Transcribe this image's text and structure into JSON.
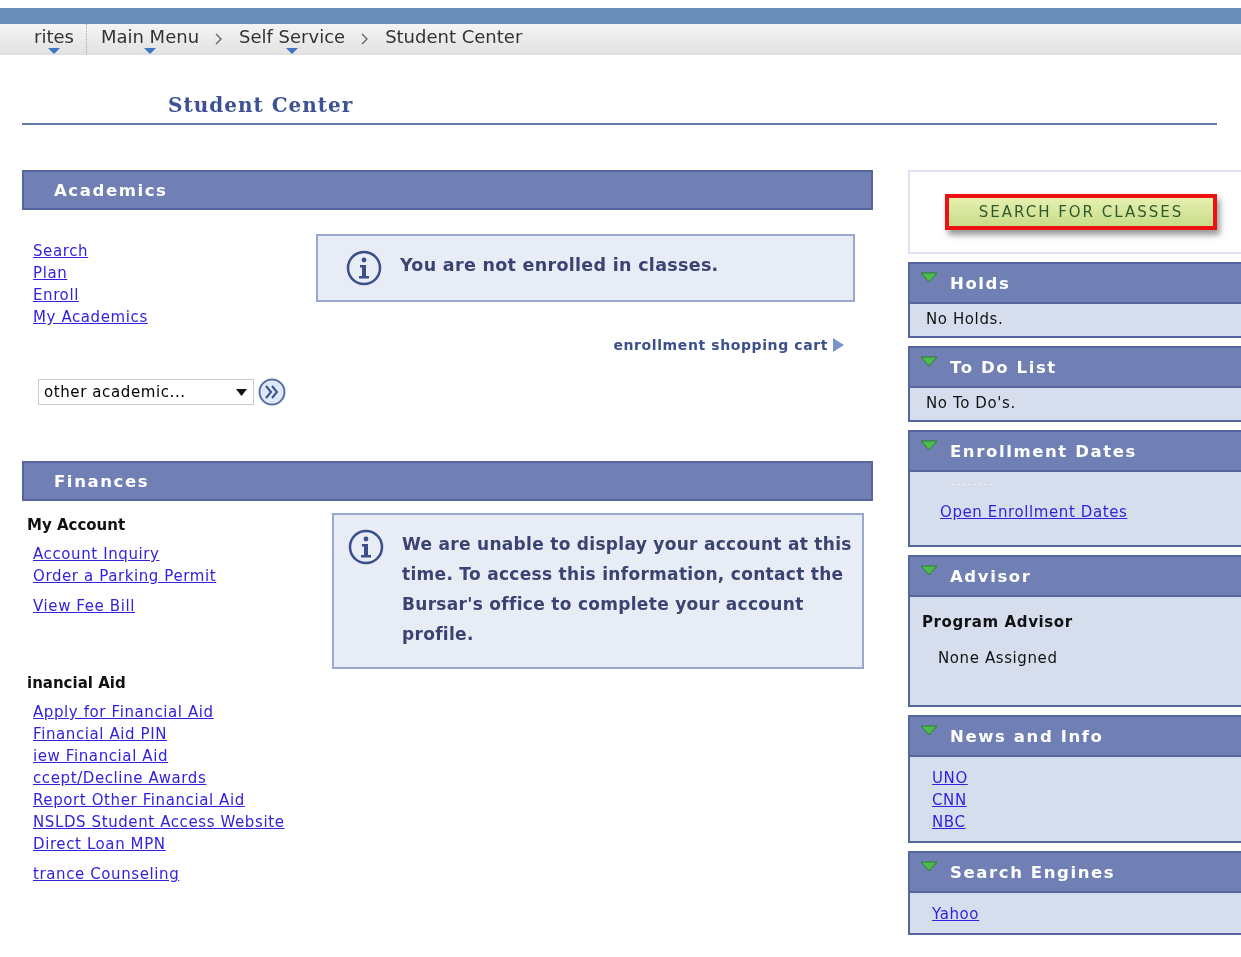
{
  "breadcrumb": [
    {
      "label": "rites",
      "menu": true
    },
    {
      "label": "Main Menu",
      "menu": true
    },
    {
      "label": "Self Service",
      "menu": true
    },
    {
      "label": "Student Center",
      "menu": false
    }
  ],
  "page_title": "Student Center",
  "academics": {
    "title": "Academics",
    "links": [
      "Search",
      "Plan",
      "Enroll",
      "My Academics"
    ],
    "message": "You are not enrolled in classes.",
    "cart_link": "enrollment shopping cart",
    "dropdown": {
      "value": "other academic..."
    }
  },
  "finances": {
    "title": "Finances",
    "groups": [
      {
        "heading": "My Account",
        "links": [
          "Account Inquiry",
          "Order a Parking Permit",
          "View Fee Bill"
        ]
      },
      {
        "heading": "inancial Aid",
        "links": [
          "Apply for Financial Aid",
          "Financial Aid PIN",
          "iew Financial Aid",
          "ccept/Decline Awards",
          "Report Other Financial Aid",
          "NSLDS Student Access Website",
          "Direct Loan MPN",
          "trance Counseling"
        ]
      }
    ],
    "message": "We are unable to display your account at this time.  To access this information, contact the Bursar's office to complete your account profile."
  },
  "search_button": {
    "label": "SEARCH FOR CLASSES",
    "highlighted": true
  },
  "pagelets": [
    {
      "title": "Holds",
      "expanded": true,
      "kind": "text",
      "text": "No Holds."
    },
    {
      "title": "To Do List",
      "expanded": true,
      "kind": "text",
      "text": "No To Do's."
    },
    {
      "title": "Enrollment Dates",
      "expanded": true,
      "kind": "links",
      "links": [
        "Open Enrollment Dates"
      ]
    },
    {
      "title": "Advisor",
      "expanded": true,
      "kind": "advisor",
      "heading": "Program Advisor",
      "text": "None Assigned"
    },
    {
      "title": "News and Info",
      "expanded": true,
      "kind": "links",
      "links": [
        "UNO",
        "CNN",
        "NBC"
      ]
    },
    {
      "title": "Search Engines",
      "expanded": true,
      "kind": "links",
      "links": [
        "Yahoo"
      ]
    }
  ]
}
